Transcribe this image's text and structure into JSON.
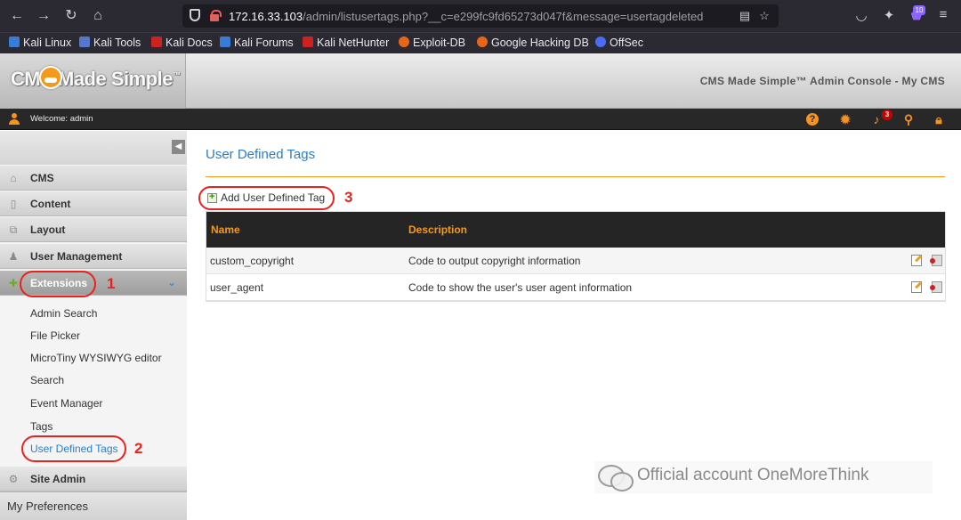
{
  "browser": {
    "url_host": "172.16.33.103",
    "url_path": "/admin/listusertags.php?__c=e299fc9fd65273d047f&message=usertagdeleted",
    "extension_badge": "10",
    "bookmarks": [
      "Kali Linux",
      "Kali Tools",
      "Kali Docs",
      "Kali Forums",
      "Kali NetHunter",
      "Exploit-DB",
      "Google Hacking DB",
      "OffSec"
    ]
  },
  "header": {
    "logo_text": "CMS Made Simple",
    "logo_tm": "™",
    "console_title": "CMS Made Simple™ Admin Console - My CMS",
    "welcome": "Welcome: admin",
    "notification_count": "3"
  },
  "sidebar": {
    "collapse_glyph": "◀",
    "items": [
      {
        "label": "CMS",
        "icon": "home-icon"
      },
      {
        "label": "Content",
        "icon": "content-icon"
      },
      {
        "label": "Layout",
        "icon": "layout-icon"
      },
      {
        "label": "User Management",
        "icon": "users-icon"
      },
      {
        "label": "Extensions",
        "icon": "puzzle-icon"
      },
      {
        "label": "Site Admin",
        "icon": "gear-icon"
      }
    ],
    "sub_items": [
      "Admin Search",
      "File Picker",
      "MicroTiny WYSIWYG editor",
      "Search",
      "Event Manager",
      "Tags",
      "User Defined Tags"
    ],
    "my_preferences": "My Preferences"
  },
  "main": {
    "page_title": "User Defined Tags",
    "add_link": "Add User Defined Tag",
    "columns": [
      "Name",
      "Description"
    ],
    "rows": [
      {
        "name": "custom_copyright",
        "description": "Code to output copyright information"
      },
      {
        "name": "user_agent",
        "description": "Code to show the user's user agent information"
      }
    ]
  },
  "annotations": [
    "1",
    "2",
    "3"
  ],
  "watermark": "Official account OneMoreThink",
  "colors": {
    "accent": "#f39a1d",
    "link": "#2a7fc9",
    "annotation": "#e8221c"
  }
}
